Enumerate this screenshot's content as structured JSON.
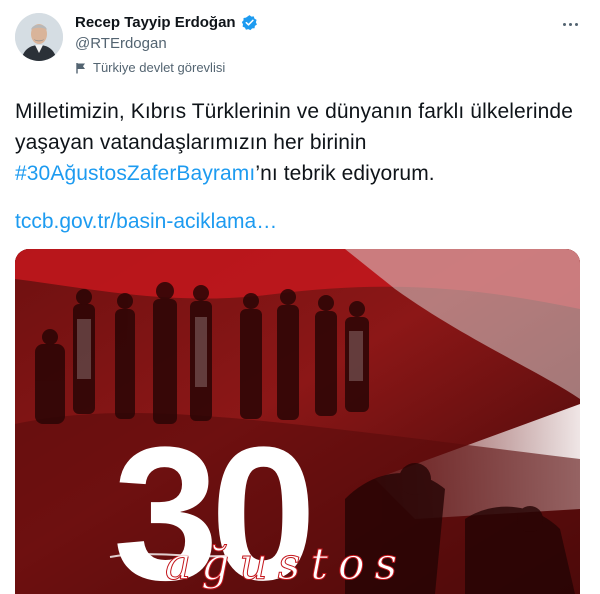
{
  "author": {
    "name": "Recep Tayyip Erdoğan",
    "handle": "@RTErdogan",
    "label": "Türkiye devlet görevlisi",
    "avatar_icon": "profile-photo",
    "verified_icon": "verified-badge-icon"
  },
  "tweet": {
    "text_before": "Milletimizin, Kıbrıs Türklerinin ve dünyanın farklı ülkelerinde yaşayan vatandaşlarımızın her birinin ",
    "hashtag": "#30AğustosZaferBayramı",
    "text_after": "’nı tebrik ediyorum.",
    "link": "tccb.gov.tr/basin-aciklama…"
  },
  "media": {
    "number": "30",
    "script_text": "ağustos",
    "accent_color": "#c4171d"
  },
  "colors": {
    "link": "#1d9bf0",
    "verified": "#1d9bf0",
    "secondary_text": "#536471"
  }
}
